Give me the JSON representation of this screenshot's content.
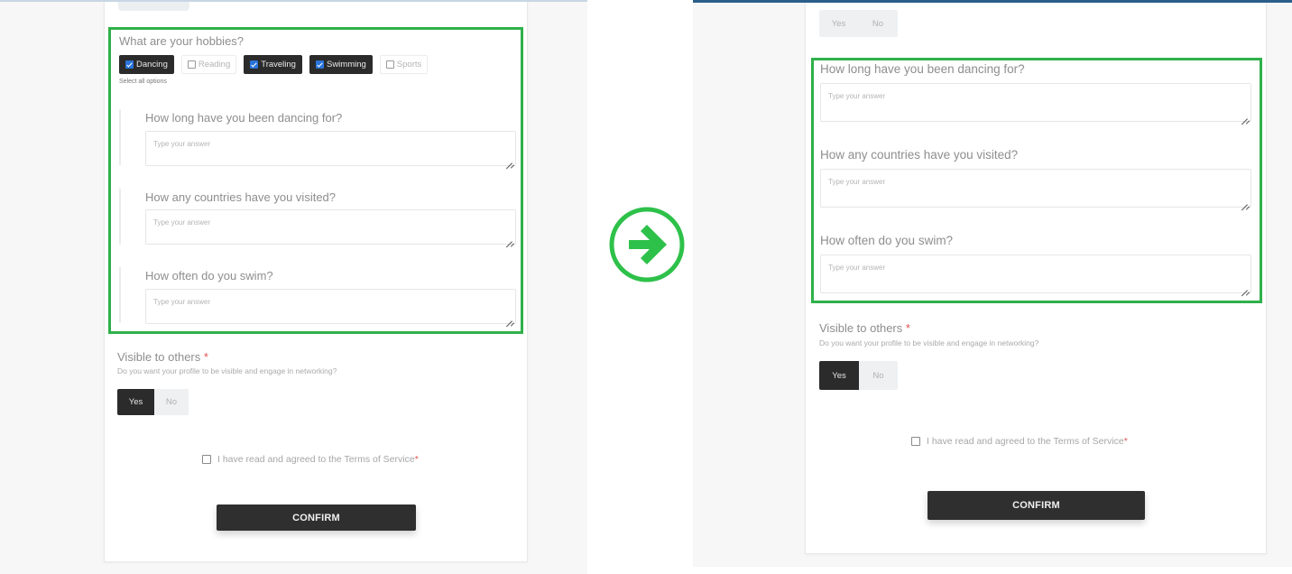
{
  "colors": {
    "highlight": "#2fb04a",
    "arrow": "#2ec14a",
    "dark_button": "#2f2f2f",
    "checkbox_checked": "#2a74d9",
    "right_topbar": "#2b5f8a",
    "required_star": "#e05555"
  },
  "arrow_icon": "arrow-right-circle-icon",
  "before": {
    "hobbies": {
      "question": "What are your hobbies?",
      "options": [
        {
          "label": "Dancing",
          "checked": true
        },
        {
          "label": "Reading",
          "checked": false
        },
        {
          "label": "Traveling",
          "checked": true
        },
        {
          "label": "Swimming",
          "checked": true
        },
        {
          "label": "Sports",
          "checked": false
        }
      ],
      "hint": "Select all options"
    },
    "followups": [
      {
        "question": "How long have you been dancing for?",
        "placeholder": "Type your answer"
      },
      {
        "question": "How any countries have you visited?",
        "placeholder": "Type your answer"
      },
      {
        "question": "How often do you swim?",
        "placeholder": "Type your answer"
      }
    ],
    "visible": {
      "label": "Visible to others",
      "required": "*",
      "hint": "Do you want your profile to be visible and engage in networking?",
      "options": [
        "Yes",
        "No"
      ],
      "selected": "Yes"
    },
    "terms": {
      "label": "I have read and agreed to the Terms of Service",
      "required": "*",
      "checked": false
    },
    "confirm_label": "CONFIRM"
  },
  "after": {
    "previous_toggle": {
      "options": [
        "Yes",
        "No"
      ],
      "selected": null
    },
    "followups": [
      {
        "question": "How long have you been dancing for?",
        "placeholder": "Type your answer"
      },
      {
        "question": "How any countries have you visited?",
        "placeholder": "Type your answer"
      },
      {
        "question": "How often do you swim?",
        "placeholder": "Type your answer"
      }
    ],
    "visible": {
      "label": "Visible to others",
      "required": "*",
      "hint": "Do you want your profile to be visible and engage in networking?",
      "options": [
        "Yes",
        "No"
      ],
      "selected": "Yes"
    },
    "terms": {
      "label": "I have read and agreed to the Terms of Service",
      "required": "*",
      "checked": false
    },
    "confirm_label": "CONFIRM"
  }
}
